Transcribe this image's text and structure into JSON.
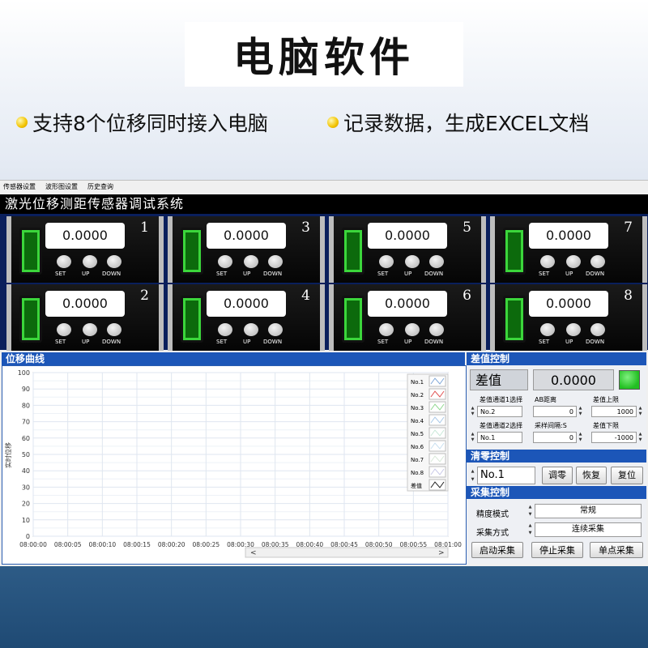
{
  "banner": {
    "title": "电脑软件",
    "features": [
      "支持8个位移同时接入电脑",
      "记录数据，生成EXCEL文档"
    ]
  },
  "app": {
    "menu": [
      "传感器设置",
      "波形图设置",
      "历史查询"
    ],
    "title": "激光位移测距传感器调试系统",
    "meters": [
      {
        "num": "1",
        "value": "0.0000"
      },
      {
        "num": "3",
        "value": "0.0000"
      },
      {
        "num": "5",
        "value": "0.0000"
      },
      {
        "num": "7",
        "value": "0.0000"
      },
      {
        "num": "2",
        "value": "0.0000"
      },
      {
        "num": "4",
        "value": "0.0000"
      },
      {
        "num": "6",
        "value": "0.0000"
      },
      {
        "num": "8",
        "value": "0.0000"
      }
    ],
    "meter_buttons": [
      "SET",
      "UP",
      "DOWN"
    ]
  },
  "plot": {
    "header": "位移曲线",
    "ylabel": "实时位移",
    "yticks": [
      "100",
      "90",
      "80",
      "70",
      "60",
      "50",
      "40",
      "30",
      "20",
      "10",
      "0"
    ],
    "xticks": [
      "08:00:00",
      "08:00:05",
      "08:00:10",
      "08:00:15",
      "08:00:20",
      "08:00:25",
      "08:00:30",
      "08:00:35",
      "08:00:40",
      "08:00:45",
      "08:00:50",
      "08:00:55",
      "08:01:00"
    ],
    "legend": [
      {
        "name": "No.1",
        "color": "#7fa7d8"
      },
      {
        "name": "No.2",
        "color": "#e05050"
      },
      {
        "name": "No.3",
        "color": "#8fd88f"
      },
      {
        "name": "No.4",
        "color": "#a8c8e8"
      },
      {
        "name": "No.5",
        "color": "#c8e8d8"
      },
      {
        "name": "No.6",
        "color": "#c8e0f0"
      },
      {
        "name": "No.7",
        "color": "#d8e8d8"
      },
      {
        "name": "No.8",
        "color": "#c8c8e8"
      },
      {
        "name": "差值",
        "color": "#202020"
      }
    ],
    "scroll_left": "<",
    "scroll_right": ">"
  },
  "chart_data": {
    "type": "line",
    "ylabel": "实时位移",
    "ylim": [
      0,
      100
    ],
    "x": [
      "08:00:00",
      "08:00:05",
      "08:00:10",
      "08:00:15",
      "08:00:20",
      "08:00:25",
      "08:00:30",
      "08:00:35",
      "08:00:40",
      "08:00:45",
      "08:00:50",
      "08:00:55",
      "08:01:00"
    ],
    "series": [
      {
        "name": "No.1",
        "values": []
      },
      {
        "name": "No.2",
        "values": []
      },
      {
        "name": "No.3",
        "values": []
      },
      {
        "name": "No.4",
        "values": []
      },
      {
        "name": "No.5",
        "values": []
      },
      {
        "name": "No.6",
        "values": []
      },
      {
        "name": "No.7",
        "values": []
      },
      {
        "name": "No.8",
        "values": []
      },
      {
        "name": "差值",
        "values": []
      }
    ],
    "grid": true,
    "legend": "top-right"
  },
  "diff": {
    "header": "差值控制",
    "label": "差值",
    "value": "0.0000",
    "indicator_color": "#22c022",
    "ch1_label": "差值通道1选择",
    "ch1_value": "No.2",
    "ab_label": "AB距离",
    "ab_value": "0",
    "upper_label": "差值上限",
    "upper_value": "1000",
    "ch2_label": "差值通道2选择",
    "ch2_value": "No.1",
    "interval_label": "采样间隔:S",
    "interval_value": "0",
    "lower_label": "差值下限",
    "lower_value": "-1000"
  },
  "zero": {
    "header": "清零控制",
    "channel": "No.1",
    "btn_zero": "调零",
    "btn_restore": "恢复",
    "btn_reset": "复位"
  },
  "acq": {
    "header": "采集控制",
    "precision_label": "精度模式",
    "precision_value": "常规",
    "mode_label": "采集方式",
    "mode_value": "连续采集",
    "btn_start": "启动采集",
    "btn_stop": "停止采集",
    "btn_single": "单点采集"
  }
}
